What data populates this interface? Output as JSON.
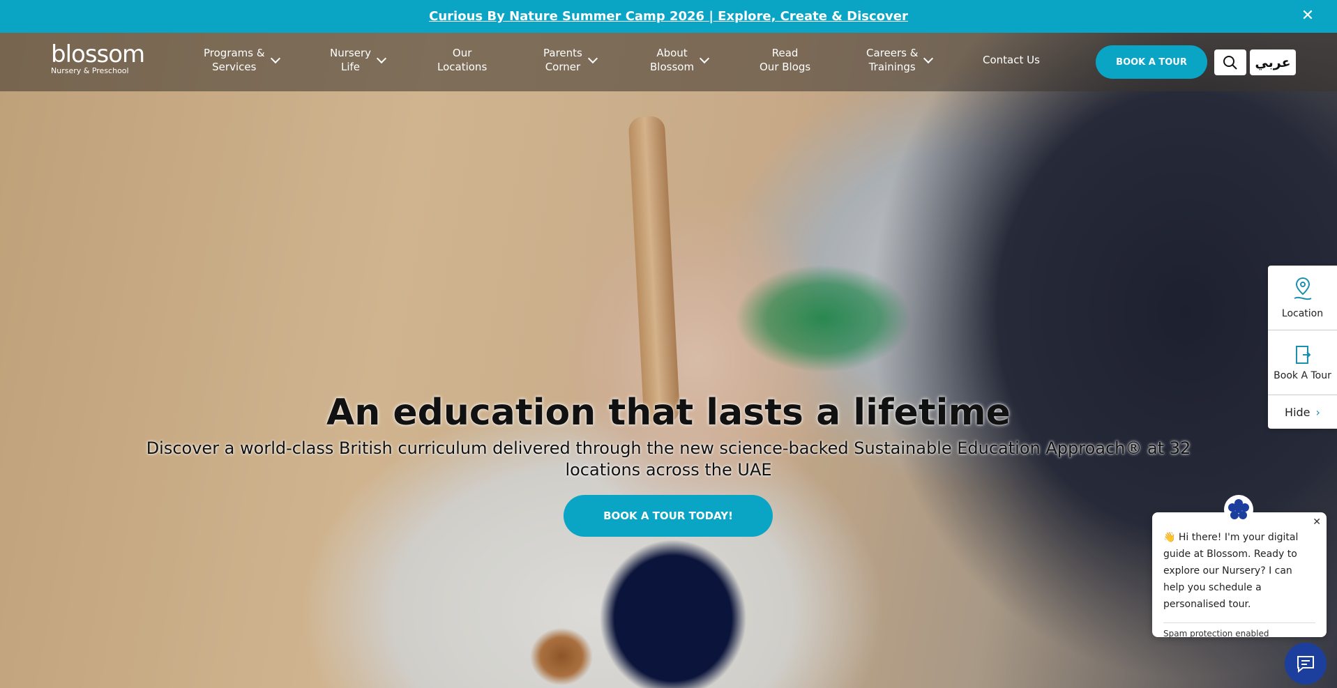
{
  "announcement": {
    "text": "Curious By Nature Summer Camp 2026 | Explore, Create & Discover",
    "close_icon": "close-icon"
  },
  "logo": {
    "word": "blossom",
    "subtitle": "Nursery & Preschool"
  },
  "nav": {
    "items": [
      {
        "line1": "Programs &",
        "line2": "Services",
        "dropdown": true
      },
      {
        "line1": "Nursery",
        "line2": "Life",
        "dropdown": true
      },
      {
        "line1": "Our",
        "line2": "Locations",
        "dropdown": false
      },
      {
        "line1": "Parents",
        "line2": "Corner",
        "dropdown": true
      },
      {
        "line1": "About",
        "line2": "Blossom",
        "dropdown": true
      },
      {
        "line1": "Read",
        "line2": "Our Blogs",
        "dropdown": false
      },
      {
        "line1": "Careers &",
        "line2": "Trainings",
        "dropdown": true
      },
      {
        "line1": "Contact Us",
        "line2": "",
        "dropdown": false
      }
    ],
    "book_tour": "BOOK A TOUR",
    "search_icon": "search-icon",
    "language": "عربي"
  },
  "hero": {
    "title": "An education that lasts a lifetime",
    "subtitle": "Discover a world-class British curriculum delivered through the new science-backed Sustainable Education Approach® at 32 locations across the UAE",
    "cta": "BOOK A TOUR TODAY!"
  },
  "side_widget": {
    "location": "Location",
    "book_tour": "Book A Tour",
    "hide": "Hide"
  },
  "chat": {
    "message": "👋 Hi there! I'm your digital guide at Blossom. Ready to explore our Nursery? I can help you schedule a personalised tour.",
    "spam": "Spam protection enabled"
  },
  "colors": {
    "accent": "#0aa5c5",
    "chat_launcher": "#1c3f9e"
  }
}
